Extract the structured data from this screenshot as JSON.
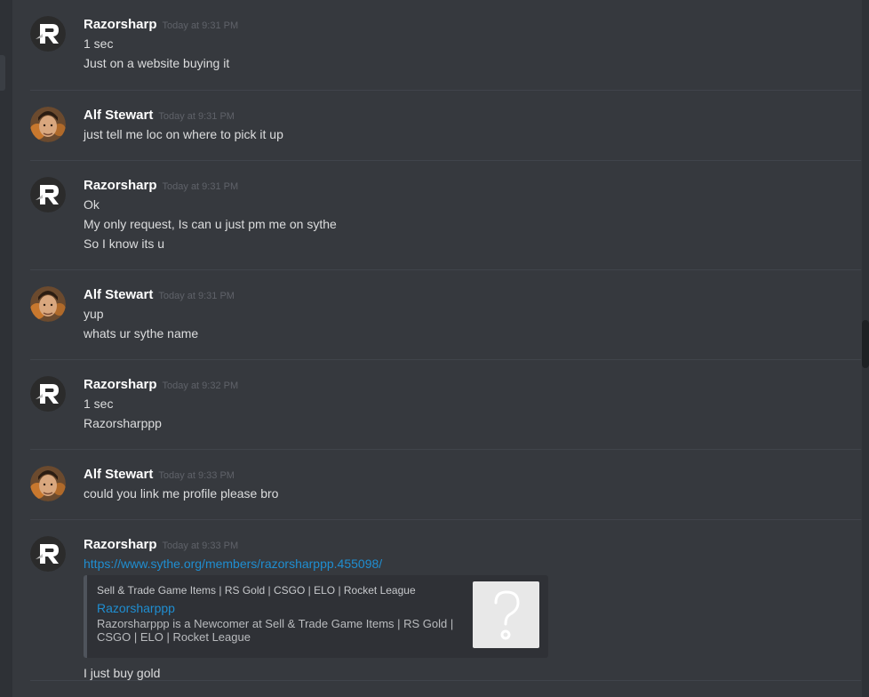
{
  "messages": [
    {
      "author": "Razorsharp",
      "time": "Today at 9:31 PM",
      "lines": [
        "1 sec",
        "Just on a website buying it"
      ]
    },
    {
      "author": "Alf Stewart",
      "time": "Today at 9:31 PM",
      "lines": [
        "just tell me loc on where to pick it up"
      ]
    },
    {
      "author": "Razorsharp",
      "time": "Today at 9:31 PM",
      "lines": [
        "Ok",
        "My only request, Is can u just pm me on sythe",
        "So I know its u"
      ]
    },
    {
      "author": "Alf Stewart",
      "time": "Today at 9:31 PM",
      "lines": [
        "yup",
        "whats ur sythe name"
      ]
    },
    {
      "author": "Razorsharp",
      "time": "Today at 9:32 PM",
      "lines": [
        "1 sec",
        "Razorsharppp"
      ]
    },
    {
      "author": "Alf Stewart",
      "time": "Today at 9:33 PM",
      "lines": [
        "could you link me profile please bro"
      ]
    },
    {
      "author": "Razorsharp",
      "time": "Today at 9:33 PM",
      "link": "https://www.sythe.org/members/razorsharppp.455098/",
      "embed": {
        "provider": "Sell & Trade Game Items | RS Gold | CSGO | ELO | Rocket League",
        "title": "Razorsharppp",
        "description": "Razorsharppp is a Newcomer at Sell & Trade Game Items | RS Gold | CSGO | ELO | Rocket League",
        "thumbnail_icon": "question-mark-icon"
      },
      "after": "I just buy gold"
    }
  ],
  "colors": {
    "background": "#36393e",
    "username": "#ffffff",
    "text": "#dcddde",
    "timestamp": "#5f6269",
    "link": "#1f8ed1",
    "embed_bg": "#2f3136"
  },
  "icons": {
    "razorsharp_avatar": "r-logo-avatar",
    "alf_avatar": "user-photo-avatar"
  }
}
